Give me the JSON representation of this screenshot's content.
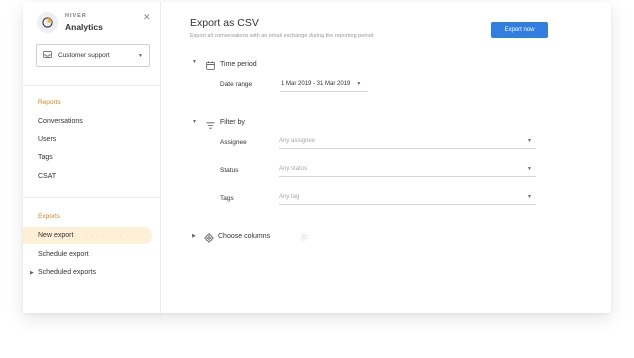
{
  "brand": {
    "company": "HIVER",
    "product": "Analytics"
  },
  "sidebar": {
    "inbox_label": "Customer support",
    "reports_title": "Reports",
    "reports_items": [
      {
        "label": "Conversations"
      },
      {
        "label": "Users"
      },
      {
        "label": "Tags"
      },
      {
        "label": "CSAT"
      }
    ],
    "exports_title": "Exports",
    "exports_items": [
      {
        "label": "New export",
        "active": true
      },
      {
        "label": "Schedule export"
      },
      {
        "label": "Scheduled exports",
        "expandable": true
      }
    ]
  },
  "main": {
    "title": "Export as CSV",
    "subtitle": "Export all conversations with an email exchange during the reporting period",
    "export_button": "Export now",
    "time_period": {
      "title": "Time period",
      "date_range_label": "Date range",
      "date_range_value": "1 Mar 2019 - 31 Mar 2019"
    },
    "filter_by": {
      "title": "Filter by",
      "filters": [
        {
          "label": "Assignee",
          "placeholder": "Any assignee"
        },
        {
          "label": "Status",
          "placeholder": "Any status"
        },
        {
          "label": "Tags",
          "placeholder": "Any tag"
        }
      ]
    },
    "choose_columns": {
      "title": "Choose columns"
    }
  },
  "colors": {
    "accent": "#d4891c",
    "active_bg": "#fdf0d6",
    "primary_button": "#2f7ee0"
  },
  "icons": {
    "brand": "pie-chart-icon",
    "close": "close-icon",
    "inbox": "inbox-icon",
    "calendar": "calendar-icon",
    "filter": "filter-icon",
    "settings": "gear-icon",
    "info": "info-icon"
  }
}
